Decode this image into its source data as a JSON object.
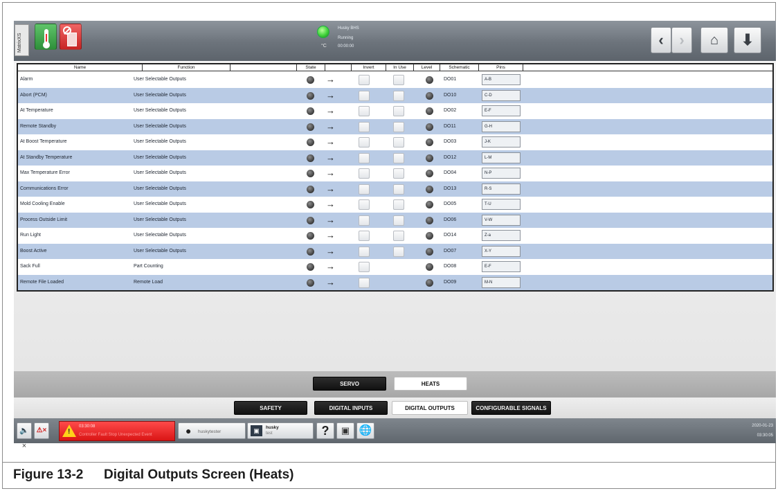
{
  "app": {
    "side_tab": "MatrixXS"
  },
  "status": {
    "degree": "°C",
    "line1": "Husky BHS",
    "line2": "Running",
    "line3": "00:00:00"
  },
  "table": {
    "headers": [
      "Name",
      "Function",
      "",
      "State",
      "",
      "Invert",
      "In Use",
      "Level",
      "Schematic",
      "Pins"
    ],
    "rows": [
      {
        "name": "Alarm",
        "function": "User Selectable Outputs",
        "schematic": "DO01",
        "pins": "A-B",
        "in_use": true
      },
      {
        "name": "Abort (PCM)",
        "function": "User Selectable Outputs",
        "schematic": "DO10",
        "pins": "C-D",
        "in_use": true
      },
      {
        "name": "At Temperature",
        "function": "User Selectable Outputs",
        "schematic": "DO02",
        "pins": "E-F",
        "in_use": true
      },
      {
        "name": "Remote Standby",
        "function": "User Selectable Outputs",
        "schematic": "DO11",
        "pins": "G-H",
        "in_use": true
      },
      {
        "name": "At Boost Temperature",
        "function": "User Selectable Outputs",
        "schematic": "DO03",
        "pins": "J-K",
        "in_use": true
      },
      {
        "name": "At Standby Temperature",
        "function": "User Selectable Outputs",
        "schematic": "DO12",
        "pins": "L-M",
        "in_use": true
      },
      {
        "name": "Max Temperature Error",
        "function": "User Selectable Outputs",
        "schematic": "DO04",
        "pins": "N-P",
        "in_use": true
      },
      {
        "name": "Communications Error",
        "function": "User Selectable Outputs",
        "schematic": "DO13",
        "pins": "R-S",
        "in_use": true
      },
      {
        "name": "Mold Cooling Enable",
        "function": "User Selectable Outputs",
        "schematic": "DO05",
        "pins": "T-U",
        "in_use": true
      },
      {
        "name": "Process Outside Limit",
        "function": "User Selectable Outputs",
        "schematic": "DO06",
        "pins": "V-W",
        "in_use": true
      },
      {
        "name": "Run Light",
        "function": "User Selectable Outputs",
        "schematic": "DO14",
        "pins": "Z-a",
        "in_use": true
      },
      {
        "name": "Boost Active",
        "function": "User Selectable Outputs",
        "schematic": "DO07",
        "pins": "X-Y",
        "in_use": true
      },
      {
        "name": "Sack Full",
        "function": "Part Counting",
        "schematic": "DO08",
        "pins": "E-F",
        "in_use": false
      },
      {
        "name": "Remote File Loaded",
        "function": "Remote Load",
        "schematic": "DO09",
        "pins": "M-N",
        "in_use": false
      }
    ]
  },
  "tabs_top": {
    "servo": "SERVO",
    "heats": "HEATS"
  },
  "tabs_bottom": {
    "safety": "SAFETY",
    "digital_inputs": "DIGITAL INPUTS",
    "digital_outputs": "DIGITAL OUTPUTS",
    "configurable_signals": "CONFIGURABLE SIGNALS"
  },
  "bottombar": {
    "alarm_time": "03:30:08",
    "alarm_message": "Controller Fault Stop Unexpected Event",
    "user": "huskytester",
    "mold_name": "husky",
    "mold_sub": "test",
    "help": "?",
    "date": "2020-01-23",
    "time": "03:30:05"
  },
  "caption": {
    "number": "Figure 13-2",
    "title": "Digital Outputs Screen (Heats)"
  },
  "colors": {
    "row_alt": "#b9cbe5",
    "tab_dark": "#111111",
    "alarm_red": "#e02020",
    "status_green": "#3fd23a"
  }
}
